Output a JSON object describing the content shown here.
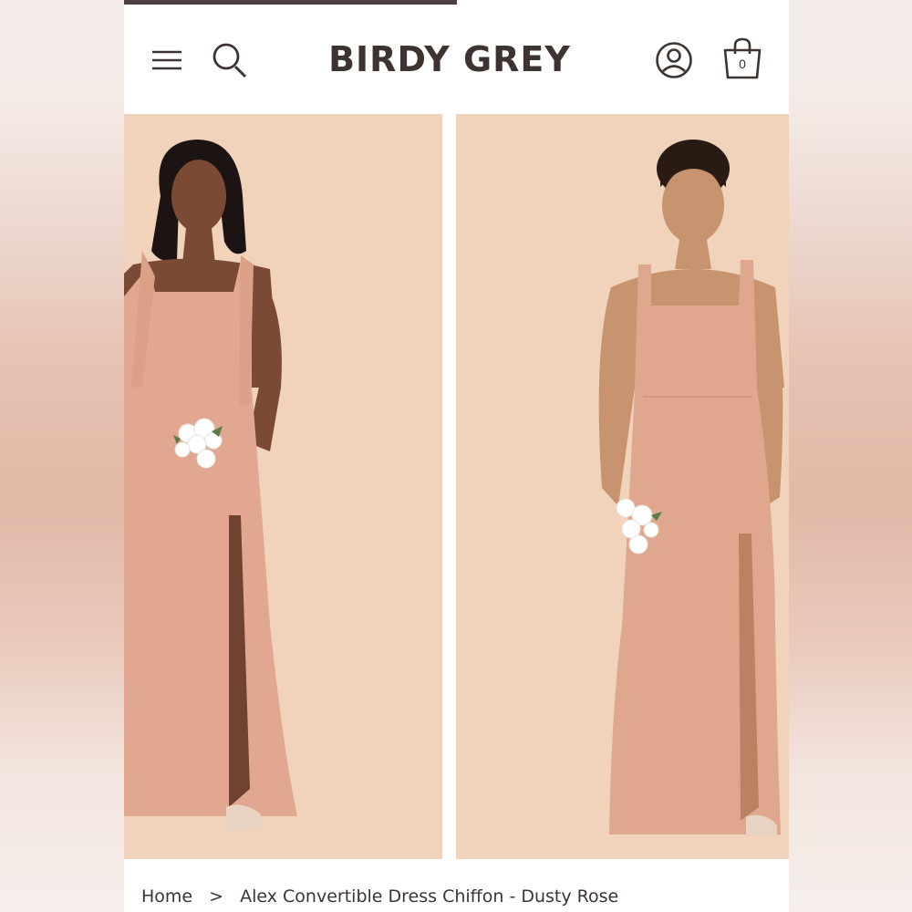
{
  "header": {
    "logo": "BIRDY GREY",
    "cart_count": "0",
    "icons": [
      "menu-icon",
      "search-icon",
      "account-icon",
      "shopping-bag-icon"
    ],
    "load_progress": 0.5
  },
  "gallery": {
    "images": [
      {
        "subject": "model in dress, front view with bouquet",
        "icon": "product-photo"
      },
      {
        "subject": "model in dress, front view with bouquet",
        "icon": "product-photo"
      }
    ]
  },
  "breadcrumb": {
    "home": "Home",
    "separator": ">",
    "current": "Alex Convertible Dress Chiffon - Dusty Rose"
  },
  "colors": {
    "brand_text": "#3d3432",
    "backdrop": "#f1d3bb",
    "dress": "#e2a790"
  }
}
